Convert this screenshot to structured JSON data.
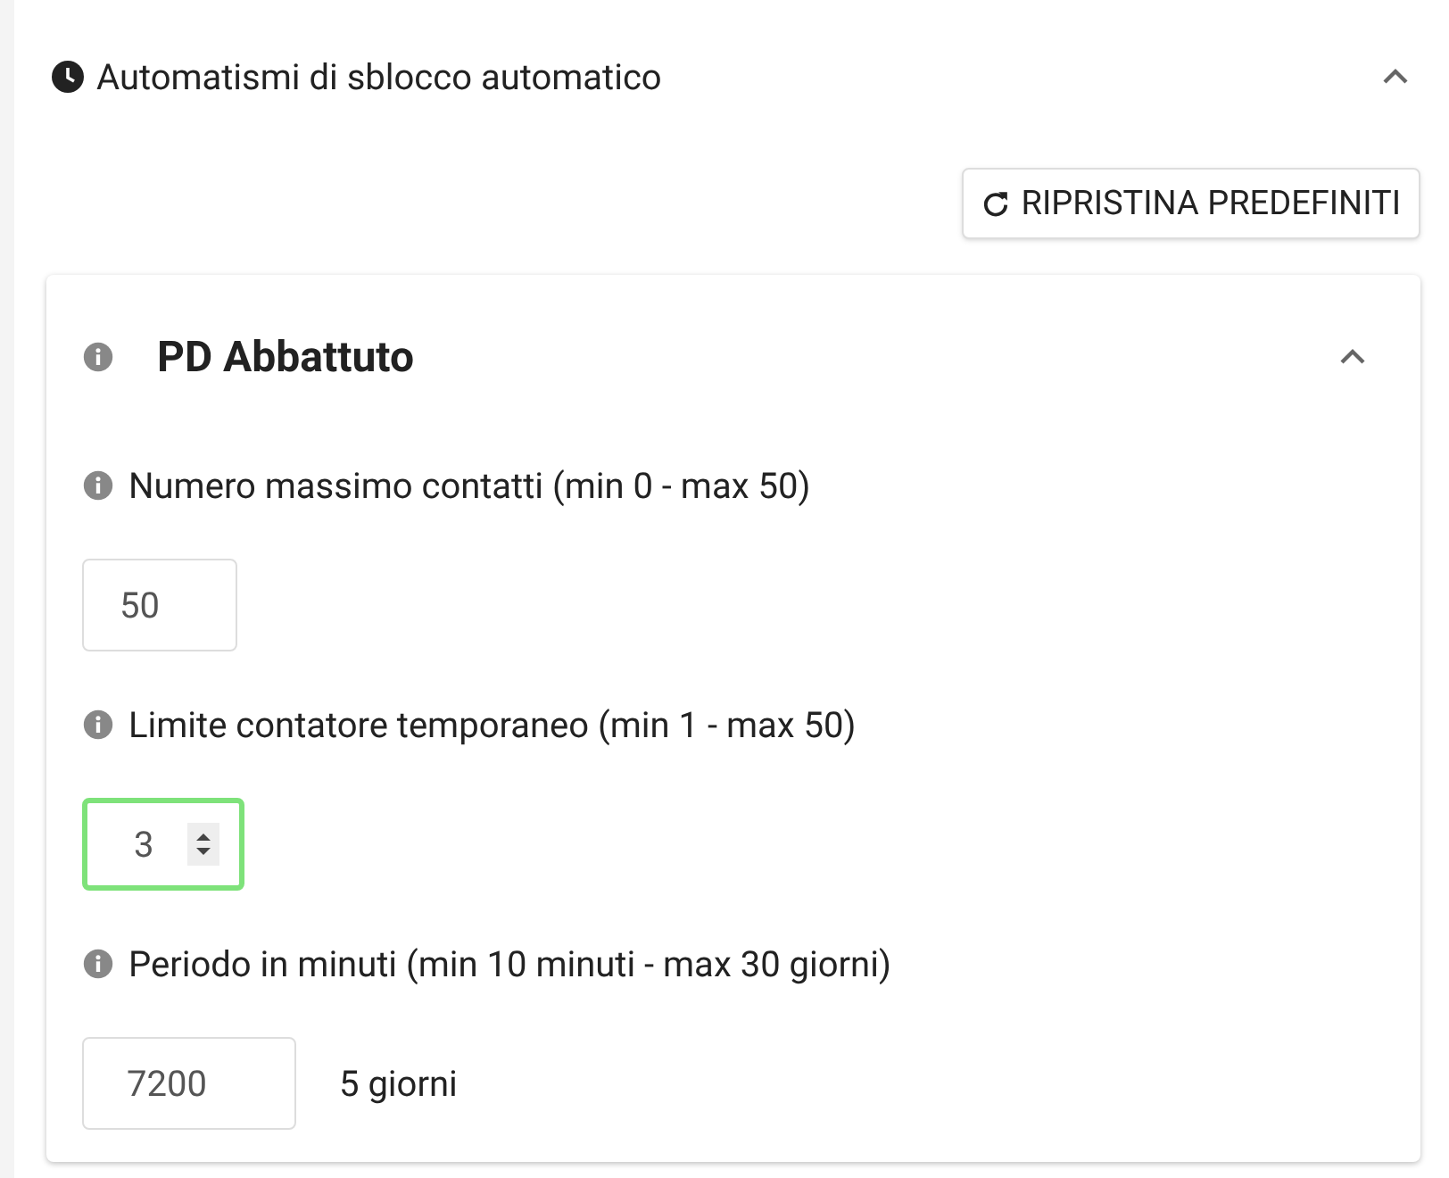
{
  "panel": {
    "title": "Automatismi di sblocco automatico",
    "expanded": true
  },
  "reset_button": {
    "label": "RIPRISTINA PREDEFINITI"
  },
  "card": {
    "title": "PD Abbattuto",
    "expanded": true,
    "fields": [
      {
        "label": "Numero massimo contatti (min 0 - max 50)",
        "value": "50",
        "focused": false
      },
      {
        "label": "Limite contatore temporaneo (min 1 - max 50)",
        "value": "3",
        "focused": true
      },
      {
        "label": "Periodo in minuti (min 10 minuti - max 30 giorni)",
        "value": "7200",
        "focused": false,
        "note": "5 giorni"
      }
    ]
  }
}
